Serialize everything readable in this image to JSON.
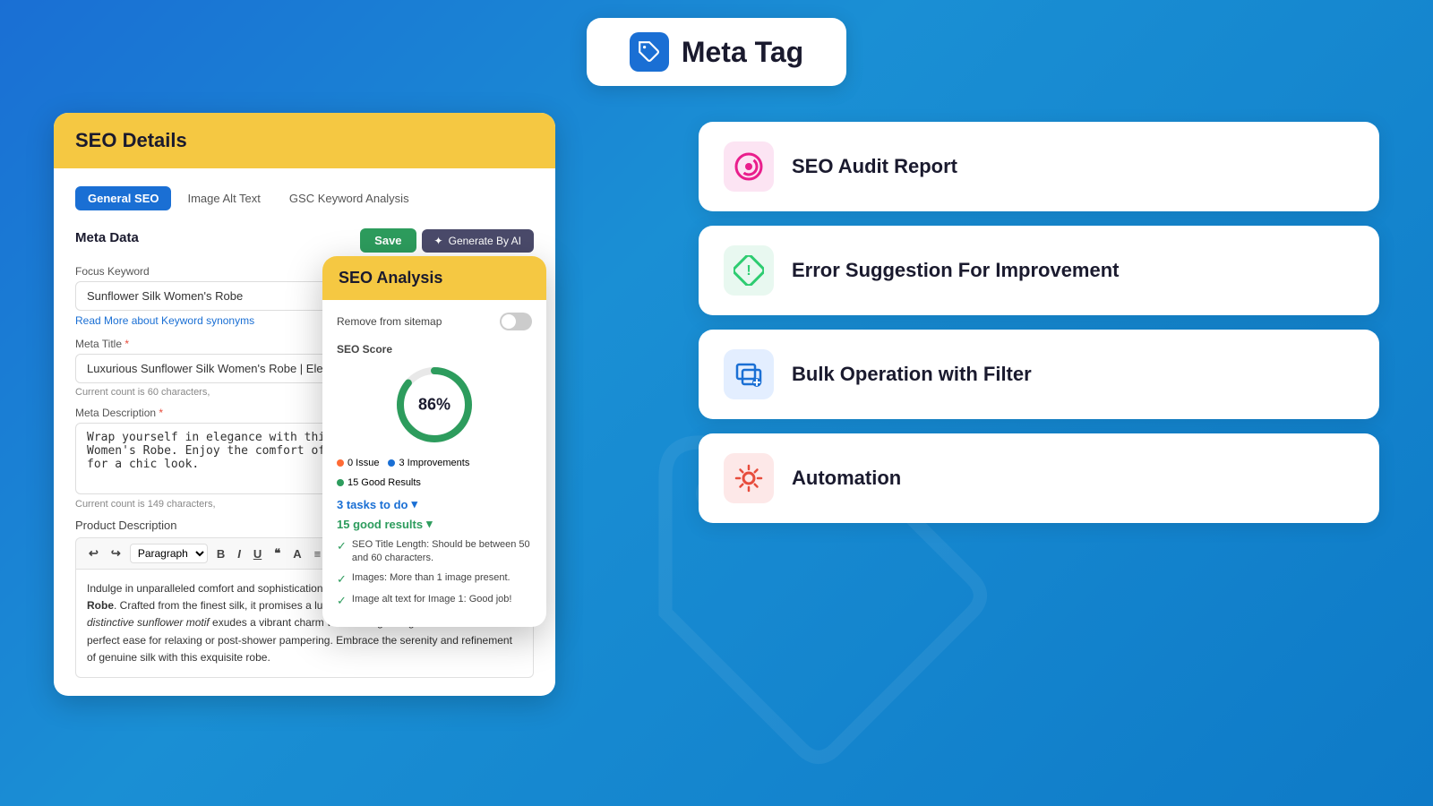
{
  "header": {
    "title": "Meta Tag",
    "icon_label": "tag-icon"
  },
  "seo_details": {
    "title": "SEO Details",
    "tabs": [
      {
        "label": "General SEO",
        "active": true
      },
      {
        "label": "Image Alt Text",
        "active": false
      },
      {
        "label": "GSC Keyword Analysis",
        "active": false
      }
    ],
    "section_title": "Meta Data",
    "btn_save": "Save",
    "btn_generate": "Generate By AI",
    "focus_keyword_label": "Focus Keyword",
    "focus_keyword_value": "Sunflower Silk Women's Robe",
    "keyword_link": "Read More about Keyword synonyms",
    "meta_title_label": "Meta Title",
    "meta_title_value": "Luxurious Sunflower Silk Women's Robe | Elegant Comfort Wear",
    "meta_title_char_count": "Current count is 60 characters,",
    "meta_desc_label": "Meta Description",
    "meta_desc_value": "Wrap yourself in elegance with this luxe Sunflower Silk Women's Robe. Enjoy the comfort of stunning sunflower design for a chic look.",
    "meta_desc_char_count": "Current count is 149 characters,",
    "product_desc_label": "Product Description",
    "editor_paragraph": "Paragraph",
    "editor_content": "Indulge in unparalleled comfort and sophistication with our Sunflower Silk Women's Robe. Crafted from the finest silk, it promises a luxurious feel against your skin. The distinctive sunflower motif exudes a vibrant charm while the lightweight material offers perfect ease for relaxing or post-shower pampering. Embrace the serenity and refinement of genuine silk with this exquisite robe."
  },
  "seo_analysis": {
    "title": "SEO Analysis",
    "toggle_label": "Remove from sitemap",
    "score_label": "SEO Score",
    "score_value": "86%",
    "score_number": 86,
    "issue_count": "0 Issue",
    "improvements_count": "3 Improvements",
    "good_results_count": "15 Good Results",
    "tasks_label": "3 tasks to do",
    "good_results_label": "15 good results",
    "results": [
      {
        "text": "SEO Title Length: Should be between 50 and 60 characters.",
        "type": "good"
      },
      {
        "text": "Images: More than 1 image present.",
        "type": "good"
      },
      {
        "text": "Image alt text for Image 1: Good job!",
        "type": "good"
      }
    ]
  },
  "features": [
    {
      "id": "seo-audit",
      "title": "SEO Audit Report",
      "icon": "seo-audit-icon",
      "icon_color": "#e91e8c",
      "bg_color": "#fce4f3"
    },
    {
      "id": "error-suggestion",
      "title": "Error Suggestion For Improvement",
      "icon": "error-suggestion-icon",
      "icon_color": "#2ecc71",
      "bg_color": "#e8f8f0"
    },
    {
      "id": "bulk-operation",
      "title": "Bulk Operation with Filter",
      "icon": "bulk-operation-icon",
      "icon_color": "#1a6fd4",
      "bg_color": "#e3eeff"
    },
    {
      "id": "automation",
      "title": "Automation",
      "icon": "automation-icon",
      "icon_color": "#e74c3c",
      "bg_color": "#fde8e8"
    }
  ],
  "colors": {
    "primary": "#1a6fd4",
    "accent_yellow": "#f5c842",
    "accent_green": "#2d9c5d",
    "accent_red": "#e74c3c",
    "accent_pink": "#e91e8c"
  }
}
